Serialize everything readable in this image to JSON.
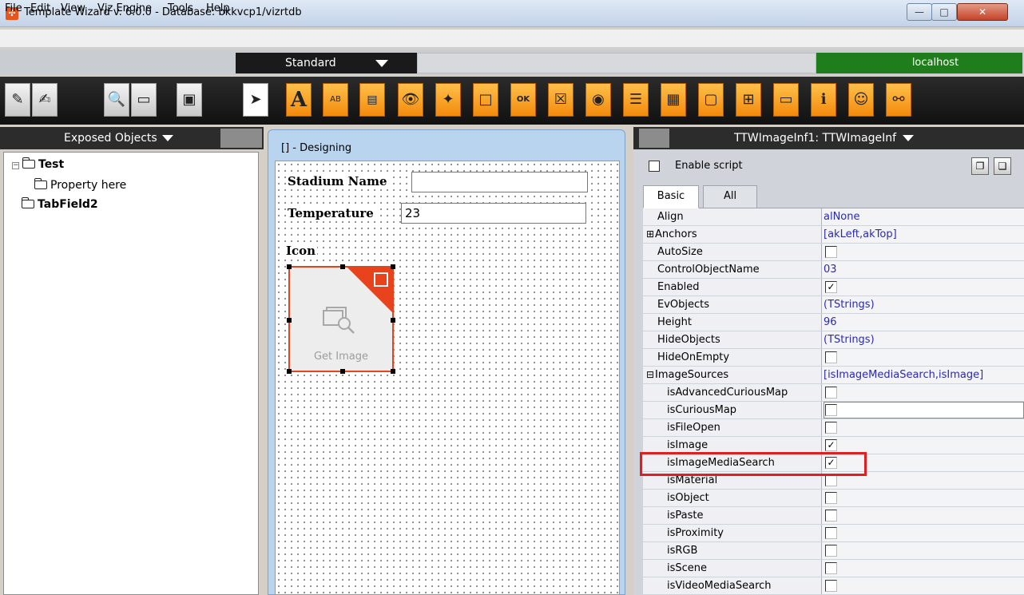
{
  "window": {
    "title": "Template Wizard v. 6.0.0 - Database: bkkvcp1/vizrtdb",
    "minimize": "—",
    "maximize": "□",
    "close": "✕"
  },
  "menu": [
    "File",
    "Edit",
    "View",
    "Vjz Engine",
    "Tools",
    "Help"
  ],
  "strip": {
    "mode": "Standard",
    "host": "localhost"
  },
  "left_panel": {
    "header": "Exposed Objects",
    "tree": {
      "root": "Test",
      "child": "Property here",
      "sibling": "TabField2"
    }
  },
  "designer": {
    "title": "[] - Designing",
    "stadium_label": "Stadium Name",
    "stadium_value": "",
    "temperature_label": "Temperature",
    "temperature_value": "23",
    "icon_label": "Icon",
    "get_image": "Get Image"
  },
  "right_panel": {
    "header": "TTWImageInf1: TTWImageInf",
    "enable_script": "Enable script",
    "tabs": [
      "Basic",
      "All"
    ],
    "properties": [
      {
        "name": "Align",
        "value": "alNone"
      },
      {
        "name": "Anchors",
        "value": "[akLeft,akTop]",
        "expander": "⊞"
      },
      {
        "name": "AutoSize",
        "check": ""
      },
      {
        "name": "ControlObjectName",
        "value": "03"
      },
      {
        "name": "Enabled",
        "check": "✓"
      },
      {
        "name": "EvObjects",
        "value": "(TStrings)"
      },
      {
        "name": "Height",
        "value": "96"
      },
      {
        "name": "HideObjects",
        "value": "(TStrings)"
      },
      {
        "name": "HideOnEmpty",
        "check": ""
      },
      {
        "name": "ImageSources",
        "value": "[isImageMediaSearch,isImage]",
        "expander": "⊟"
      },
      {
        "name": "isAdvancedCuriousMap",
        "check": "",
        "sub": true
      },
      {
        "name": "isCuriousMap",
        "check": "",
        "sub": true,
        "editing": true
      },
      {
        "name": "isFileOpen",
        "check": "",
        "sub": true
      },
      {
        "name": "isImage",
        "check": "✓",
        "sub": true
      },
      {
        "name": "isImageMediaSearch",
        "check": "✓",
        "sub": true
      },
      {
        "name": "isMaterial",
        "check": "",
        "sub": true
      },
      {
        "name": "isObject",
        "check": "",
        "sub": true
      },
      {
        "name": "isPaste",
        "check": "",
        "sub": true
      },
      {
        "name": "isProximity",
        "check": "",
        "sub": true
      },
      {
        "name": "isRGB",
        "check": "",
        "sub": true
      },
      {
        "name": "isScene",
        "check": "",
        "sub": true
      },
      {
        "name": "isVideoMediaSearch",
        "check": "",
        "sub": true
      }
    ]
  },
  "colors": {
    "accent_orange": "#f28a0c",
    "host_green": "#1f7d1b",
    "highlight_red": "#e02020",
    "value_blue": "#2a2ab0"
  }
}
